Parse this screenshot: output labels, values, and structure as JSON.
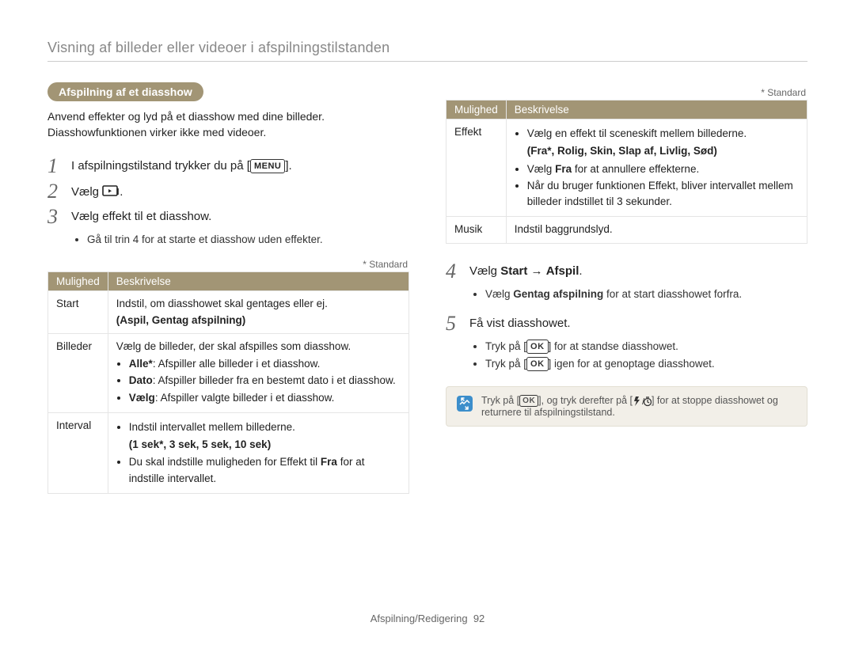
{
  "page_heading": "Visning af billeder eller videoer i afspilningstilstanden",
  "section_pill": "Afspilning af et diasshow",
  "intro": "Anvend effekter og lyd på et diasshow med dine billeder. Diasshowfunktionen virker ikke med videoer.",
  "steps": {
    "s1_prefix": "I afspilningstilstand trykker du på [",
    "s1_btn": "MENU",
    "s1_suffix": "].",
    "s2_prefix": "Vælg ",
    "s2_icon": "slideshow-icon",
    "s2_suffix": ".",
    "s3": "Vælg effekt til et diasshow.",
    "s3_bullet": "Gå til trin 4 for at starte et diasshow uden effekter.",
    "s4_pre": "Vælg ",
    "s4_b1": "Start",
    "s4_arrow": " → ",
    "s4_b2": "Afspil",
    "s4_suffix": ".",
    "s4_bullet_pre": "Vælg ",
    "s4_bullet_bold": "Gentag afspilning",
    "s4_bullet_post": " for at start diasshowet forfra.",
    "s5": "Få vist diasshowet.",
    "s5_b1_pre": "Tryk på [",
    "s5_b1_btn": "OK",
    "s5_b1_post": "] for at standse diasshowet.",
    "s5_b2_pre": "Tryk på [",
    "s5_b2_btn": "OK",
    "s5_b2_post": "] igen for at genoptage diasshowet."
  },
  "standard_note": "* Standard",
  "table_headers": {
    "col1": "Mulighed",
    "col2": "Beskrivelse"
  },
  "table_left": [
    {
      "label": "Start",
      "desc_line": "Indstil, om diasshowet skal gentages eller ej.",
      "paren": "(Aspil, Gentag afspilning)"
    },
    {
      "label": "Billeder",
      "lead": "Vælg de billeder, der skal afspilles som diasshow.",
      "items": [
        {
          "bold": "Alle*",
          "rest": ": Afspiller alle billeder i et diasshow."
        },
        {
          "bold": "Dato",
          "rest": ": Afspiller billeder fra en bestemt dato i et diasshow."
        },
        {
          "bold": "Vælg",
          "rest": ": Afspiller valgte billeder i et diasshow."
        }
      ]
    },
    {
      "label": "Interval",
      "items_plain": [
        "Indstil intervallet mellem billederne.",
        {
          "paren": "(1 sek*, 3 sek, 5 sek, 10 sek)"
        },
        {
          "pre": "Du skal indstille muligheden for Effekt til ",
          "bold": "Fra",
          "post": " for at indstille intervallet."
        }
      ]
    }
  ],
  "table_right": [
    {
      "label": "Effekt",
      "items": [
        "Vælg en effekt til sceneskift mellem billederne.",
        {
          "paren": "(Fra*, Rolig, Skin, Slap af, Livlig, Sød)"
        },
        {
          "pre": "Vælg ",
          "bold": "Fra",
          "post": " for at annullere effekterne."
        },
        "Når du bruger funktionen Effekt, bliver intervallet mellem billeder indstillet til 3 sekunder."
      ]
    },
    {
      "label": "Musik",
      "desc_line": "Indstil baggrundslyd."
    }
  ],
  "notebox": {
    "pre": "Tryk på [",
    "btn": "OK",
    "mid": "], og tryk derefter på [",
    "icons": "flash/timer",
    "post": "] for at stoppe diasshowet og returnere til afspilningstilstand."
  },
  "footer": {
    "section": "Afspilning/Redigering",
    "page": "92"
  }
}
